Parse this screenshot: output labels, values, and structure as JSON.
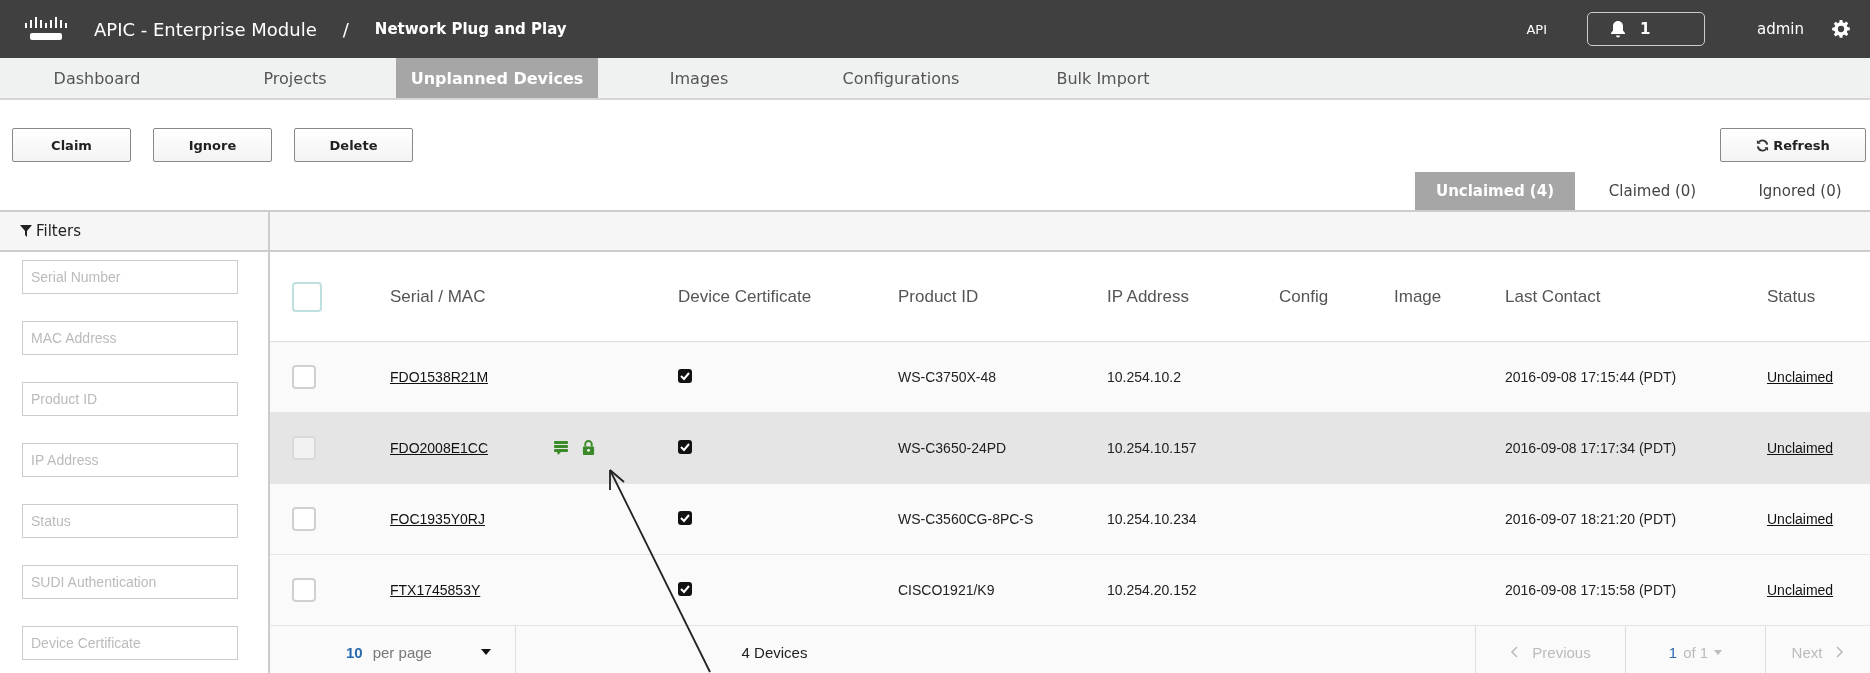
{
  "header": {
    "product": "APIC - Enterprise Module",
    "separator": "/",
    "page": "Network Plug and Play",
    "api": "API",
    "notifications": "1",
    "user": "admin"
  },
  "nav": [
    {
      "label": "Dashboard",
      "selected": false
    },
    {
      "label": "Projects",
      "selected": false
    },
    {
      "label": "Unplanned Devices",
      "selected": true
    },
    {
      "label": "Images",
      "selected": false
    },
    {
      "label": "Configurations",
      "selected": false
    },
    {
      "label": "Bulk Import",
      "selected": false
    }
  ],
  "actions": [
    "Claim",
    "Ignore",
    "Delete"
  ],
  "refresh": "Refresh",
  "status_tabs": [
    {
      "label": "Unclaimed (4)",
      "selected": true
    },
    {
      "label": "Claimed (0)",
      "selected": false
    },
    {
      "label": "Ignored (0)",
      "selected": false
    }
  ],
  "filters": {
    "title": "Filters",
    "fields": [
      {
        "placeholder": "Serial Number"
      },
      {
        "placeholder": "MAC Address"
      },
      {
        "placeholder": "Product ID"
      },
      {
        "placeholder": "IP Address"
      },
      {
        "placeholder": "Status"
      },
      {
        "placeholder": "SUDI Authentication"
      },
      {
        "placeholder": "Device Certificate"
      }
    ]
  },
  "table": {
    "select_all": {
      "checked": false
    },
    "columns": [
      "Serial / MAC",
      "Device Certificate",
      "Product ID",
      "IP Address",
      "Config",
      "Image",
      "Last Contact",
      "Status"
    ],
    "rows": [
      {
        "selected": false,
        "checked": false,
        "serial": "FDO1538R21M",
        "icons": [],
        "certificate": true,
        "product_id": "WS-C3750X-48",
        "ip": "10.254.10.2",
        "last_contact": "2016-09-08 17:15:44 (PDT)",
        "status": "Unclaimed"
      },
      {
        "selected": true,
        "checked": false,
        "serial": "FDO2008E1CC",
        "icons": [
          {
            "kind": "notes"
          },
          {
            "kind": "lock"
          }
        ],
        "certificate": true,
        "product_id": "WS-C3650-24PD",
        "ip": "10.254.10.157",
        "last_contact": "2016-09-08 17:17:34 (PDT)",
        "status": "Unclaimed"
      },
      {
        "selected": false,
        "checked": false,
        "serial": "FOC1935Y0RJ",
        "icons": [],
        "certificate": true,
        "product_id": "WS-C3560CG-8PC-S",
        "ip": "10.254.10.234",
        "last_contact": "2016-09-07 18:21:20 (PDT)",
        "status": "Unclaimed"
      },
      {
        "selected": false,
        "checked": false,
        "serial": "FTX1745853Y",
        "icons": [],
        "certificate": true,
        "product_id": "CISCO1921/K9",
        "ip": "10.254.20.152",
        "last_contact": "2016-09-08 17:15:58 (PDT)",
        "status": "Unclaimed"
      }
    ]
  },
  "footer": {
    "per_page_value": "10",
    "per_page_label": "per page",
    "count": "4 Devices",
    "previous": "Previous",
    "page_current": "1",
    "page_of": "of 1",
    "next": "Next"
  }
}
